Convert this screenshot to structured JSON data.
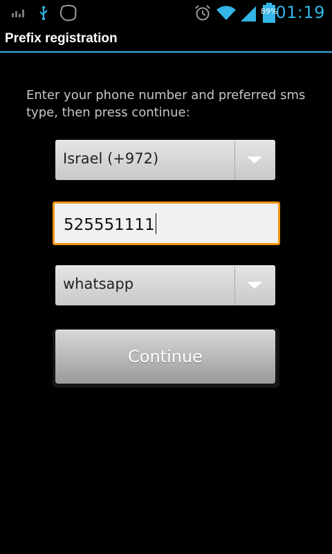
{
  "statusbar": {
    "left_icons": [
      "signal-bars-icon",
      "usb-icon",
      "blob-icon"
    ],
    "right_icons": [
      "alarm-icon",
      "wifi-icon",
      "cell-signal-icon",
      "battery-icon"
    ],
    "battery_pct": "89%",
    "time": "01:19"
  },
  "header": {
    "title": "Prefix registration"
  },
  "form": {
    "instructions": "Enter your phone number and preferred sms type, then press continue:",
    "country_selected": "Israel (+972)",
    "phone_value": "525551111",
    "sms_type_selected": "whatsapp",
    "continue_label": "Continue"
  },
  "colors": {
    "accent": "#33b5e5",
    "focus": "#f29410"
  }
}
